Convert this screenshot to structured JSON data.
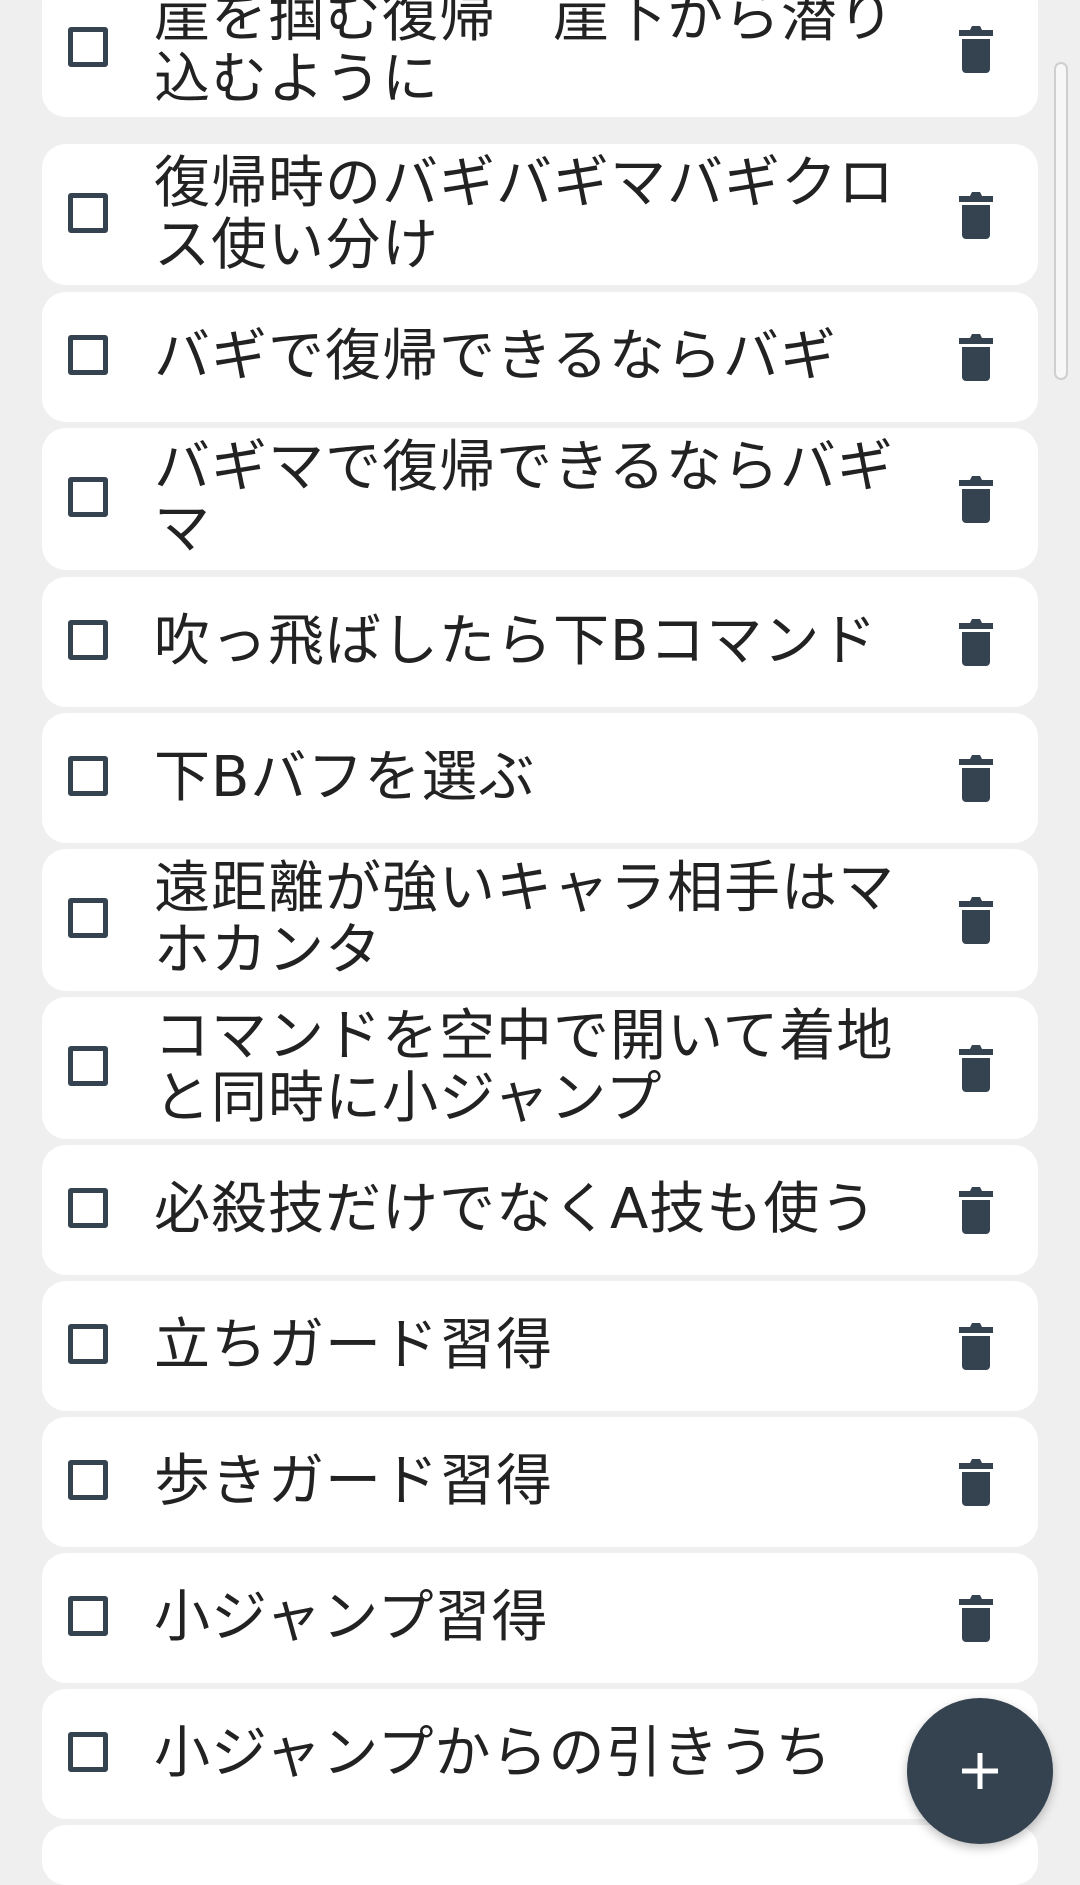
{
  "todo_list": {
    "items": [
      {
        "label": "崖を掴む復帰　崖下から潜り込むように",
        "checked": false
      },
      {
        "label": "復帰時のバギバギマバギクロス使い分け",
        "checked": false
      },
      {
        "label": "バギで復帰できるならバギ",
        "checked": false
      },
      {
        "label": "バギマで復帰できるならバギマ",
        "checked": false
      },
      {
        "label": "吹っ飛ばしたら下Bコマンド",
        "checked": false
      },
      {
        "label": "下Bバフを選ぶ",
        "checked": false
      },
      {
        "label": "遠距離が強いキャラ相手はマホカンタ",
        "checked": false
      },
      {
        "label": "コマンドを空中で開いて着地と同時に小ジャンプ",
        "checked": false
      },
      {
        "label": "必殺技だけでなくA技も使う",
        "checked": false
      },
      {
        "label": "立ちガード習得",
        "checked": false
      },
      {
        "label": "歩きガード習得",
        "checked": false
      },
      {
        "label": "小ジャンプ習得",
        "checked": false
      },
      {
        "label": "小ジャンプからの引きうち",
        "checked": false
      }
    ],
    "icons": {
      "checkbox": "checkbox-outline-icon",
      "delete": "trash-icon"
    }
  },
  "fab": {
    "icon": "plus-icon"
  },
  "colors": {
    "accent": "#34434f",
    "card": "#ffffff",
    "background": "#efefef",
    "text": "#222222"
  }
}
